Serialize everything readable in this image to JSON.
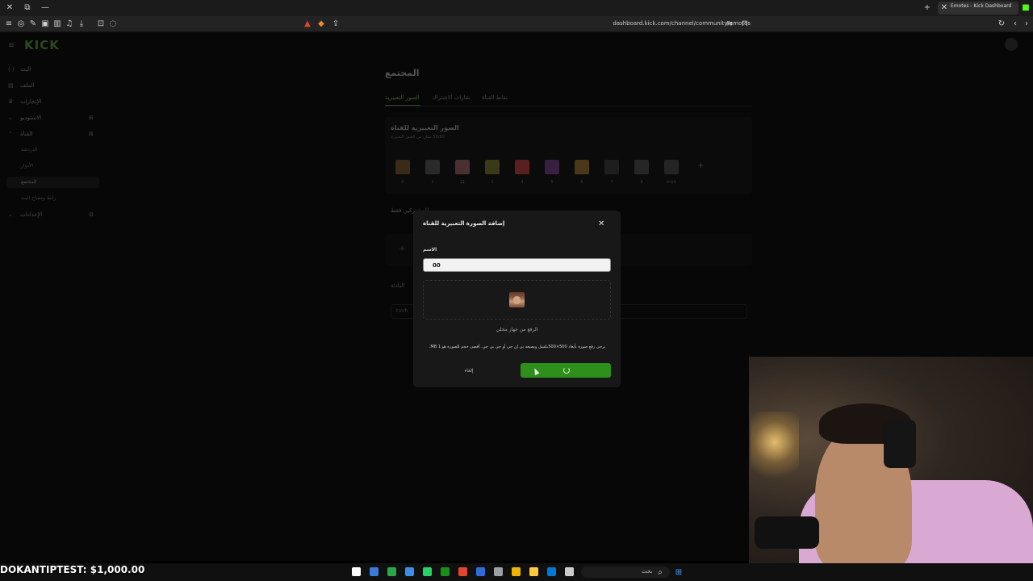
{
  "browser": {
    "tab_title": "Emotes - Kick Dashboard",
    "url": "dashboard.kick.com/channel/community/emotes"
  },
  "dashboard": {
    "logo": "KICK",
    "sidebar": {
      "items": [
        {
          "label": "البث",
          "icon": "radio-icon"
        },
        {
          "label": "الملف",
          "icon": "profile-icon"
        },
        {
          "label": "الإنجازات",
          "icon": "trophy-icon"
        },
        {
          "label": "الاستوديو",
          "icon": "chevron-down-icon"
        },
        {
          "label": "القناة",
          "icon": "chevron-up-icon"
        },
        {
          "label": "الإعدادات",
          "icon": "chevron-down-icon"
        }
      ],
      "channel_sub": [
        "الدردشة",
        "الأدوار",
        "المجتمع",
        "رابط ومفتاح البث"
      ]
    },
    "page_title": "المجتمع",
    "tabs": [
      "الصور التعبيرية",
      "شارات الاشتراك",
      "نقاط القناة"
    ],
    "emotes_card": {
      "title": "الصور التعبيرية للقناة",
      "subtitle": "50/80 مكان من الصور التعبيرية",
      "emote_labels": [
        "0",
        "1",
        "11",
        "2",
        "4",
        "5",
        "6",
        "7",
        "8",
        "tmrh"
      ],
      "emote_colors": [
        "#3a2a18",
        "#2a2a2a",
        "#4a3030",
        "#3a3a18",
        "#5a2020",
        "#3a2040",
        "#4a3818",
        "#1e1e1e",
        "#262626",
        "#242424"
      ]
    },
    "subscribers_title": "للمشتركين فقط",
    "prefix_title": "البادئة",
    "prefix_value": "tmrh"
  },
  "modal": {
    "title": "إضافة الصورة التعبيرية للقناة",
    "name_label": "الاسم",
    "name_value": "00",
    "upload_text": "الرفع من جهاز محلي",
    "hint": "يرجى رفع صورة بأبعاد 500×500بكسل وبصيغة بي إن جي أو جي بي جي. أقصى حجم للصورة هو 1 MB.",
    "cancel_label": "إلغاء"
  },
  "overlay": {
    "donation_text": "DOKANTIPTEST: $1,000.00"
  },
  "taskbar": {
    "search_label": "بحث",
    "app_colors": [
      "#fff",
      "#3a7bd5",
      "#2aa54a",
      "#3a8ee6",
      "#25d366",
      "#1a8d1a",
      "#e0452e",
      "#2f6cd8",
      "#9aa0a6",
      "#f0b400",
      "#ffc83d",
      "#0078d4",
      "#2aa0e0",
      "#ccc"
    ]
  },
  "colors": {
    "accent": "#2e8f1a",
    "modal_bg": "#181818"
  }
}
